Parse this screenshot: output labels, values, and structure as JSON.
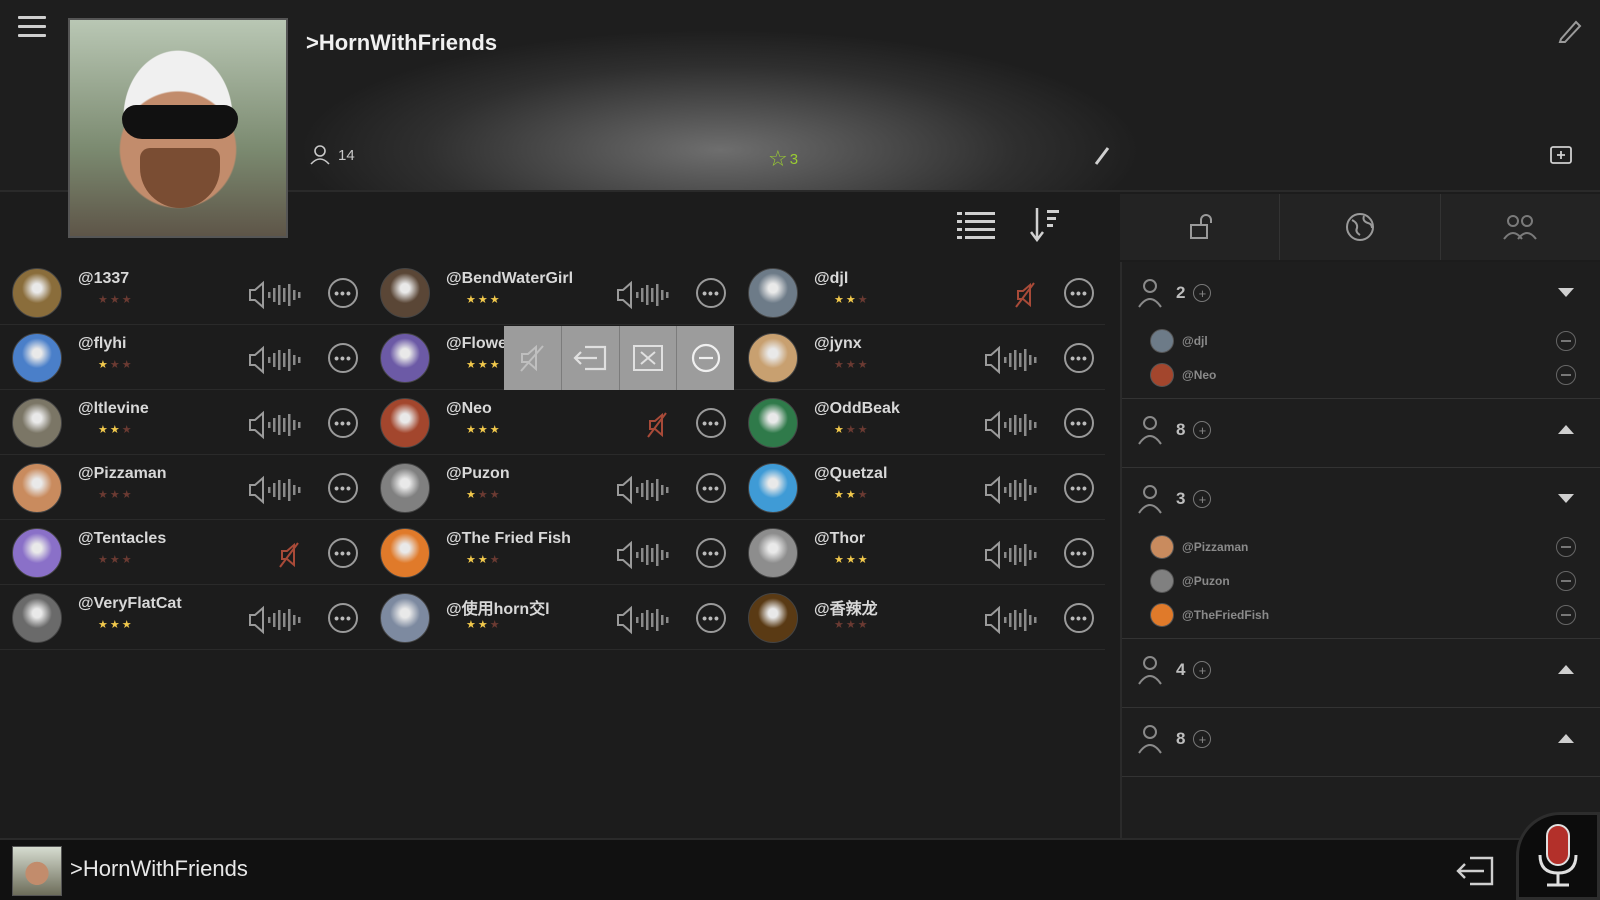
{
  "header": {
    "room_title": ">HornWithFriends",
    "member_count": "14",
    "star_count": "3"
  },
  "users": [
    [
      {
        "name": "@1337",
        "stars": 0,
        "avatar": "#8a6d3b",
        "muted": false
      },
      {
        "name": "@BendWaterGirl",
        "stars": 3,
        "avatar": "#5a4636",
        "muted": false
      },
      {
        "name": "@djl",
        "stars": 2,
        "avatar": "#6d7b88",
        "muted": true
      }
    ],
    [
      {
        "name": "@flyhi",
        "stars": 1,
        "avatar": "#4a7fc9",
        "muted": false
      },
      {
        "name": "@Flowe",
        "stars": 3,
        "avatar": "#6c5aa6",
        "muted": false
      },
      {
        "name": "@jynx",
        "stars": 0,
        "avatar": "#c8a070",
        "muted": false
      }
    ],
    [
      {
        "name": "@ltlevine",
        "stars": 2,
        "avatar": "#7b7666",
        "muted": false
      },
      {
        "name": "@Neo",
        "stars": 3,
        "avatar": "#a3462d",
        "muted": true
      },
      {
        "name": "@OddBeak",
        "stars": 1,
        "avatar": "#2f7a4a",
        "muted": false
      }
    ],
    [
      {
        "name": "@Pizzaman",
        "stars": 0,
        "avatar": "#c98b5e",
        "muted": false
      },
      {
        "name": "@Puzon",
        "stars": 1,
        "avatar": "#808080",
        "muted": false
      },
      {
        "name": "@Quetzal",
        "stars": 2,
        "avatar": "#3f9bd6",
        "muted": false
      }
    ],
    [
      {
        "name": "@Tentacles",
        "stars": 0,
        "avatar": "#8a70c8",
        "muted": true
      },
      {
        "name": "@The Fried Fish",
        "stars": 2,
        "avatar": "#e07a2a",
        "muted": false
      },
      {
        "name": "@Thor",
        "stars": 3,
        "avatar": "#8d8d8d",
        "muted": false
      }
    ],
    [
      {
        "name": "@VeryFlatCat",
        "stars": 3,
        "avatar": "#6a6a6a",
        "muted": false
      },
      {
        "name": "@使用horn交l",
        "stars": 2,
        "avatar": "#7d8aa0",
        "muted": false
      },
      {
        "name": "@香辣龙",
        "stars": 0,
        "avatar": "#5a3a14",
        "muted": false
      }
    ]
  ],
  "groups": [
    {
      "count": "2",
      "expanded": true,
      "members": [
        {
          "name": "@djl",
          "avatar": "#6d7b88"
        },
        {
          "name": "@Neo",
          "avatar": "#a3462d"
        }
      ]
    },
    {
      "count": "8",
      "expanded": false,
      "members": []
    },
    {
      "count": "3",
      "expanded": true,
      "members": [
        {
          "name": "@Pizzaman",
          "avatar": "#c98b5e"
        },
        {
          "name": "@Puzon",
          "avatar": "#808080"
        },
        {
          "name": "@TheFriedFish",
          "avatar": "#e07a2a"
        }
      ]
    },
    {
      "count": "4",
      "expanded": false,
      "members": []
    },
    {
      "count": "8",
      "expanded": false,
      "members": []
    }
  ],
  "footer": {
    "room_title": ">HornWithFriends"
  }
}
